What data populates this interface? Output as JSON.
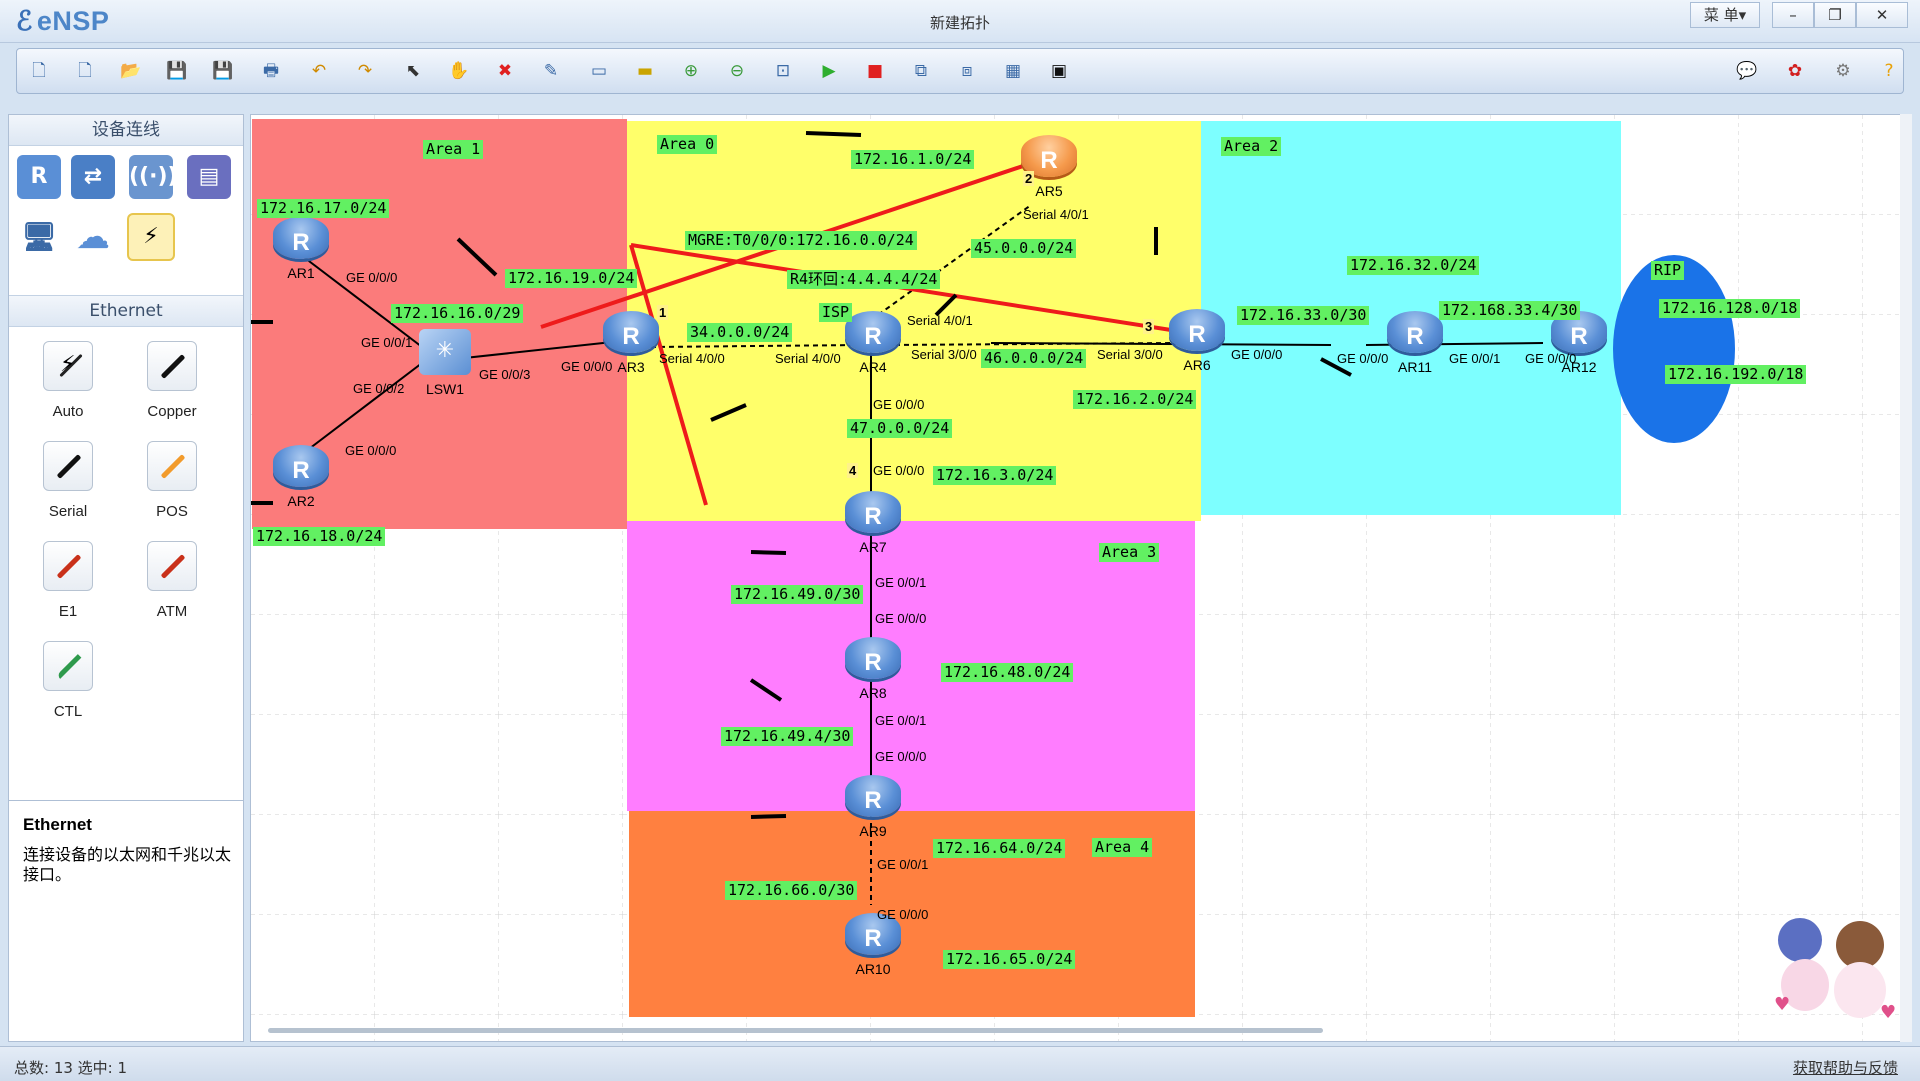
{
  "app": {
    "name": "eNSP",
    "window_title": "新建拓扑",
    "menu_label": "菜 单▾"
  },
  "toolbar": {
    "items": [
      "new-topology",
      "new-template",
      "open",
      "save",
      "save-as",
      "print",
      "undo",
      "redo",
      "select",
      "pan",
      "delete",
      "delete-links",
      "text",
      "rect",
      "zoom-in",
      "zoom-out",
      "fit",
      "start",
      "stop",
      "capture",
      "layout",
      "grid",
      "console"
    ]
  },
  "left_panel": {
    "devices_header": "设备连线",
    "ethernet_header": "Ethernet",
    "cables": [
      {
        "label": "Auto",
        "color": "#222"
      },
      {
        "label": "Copper",
        "color": "#111"
      },
      {
        "label": "Serial",
        "color": "#111"
      },
      {
        "label": "POS",
        "color": "#f29b2c"
      },
      {
        "label": "E1",
        "color": "#c9311a"
      },
      {
        "label": "ATM",
        "color": "#c9311a"
      },
      {
        "label": "CTL",
        "color": "#2e9a4c"
      }
    ],
    "desc_title": "Ethernet",
    "desc_text": "连接设备的以太网和千兆以太接口。"
  },
  "status": {
    "text": "总数: 13  选中: 1",
    "help": "获取帮助与反馈"
  },
  "areas": {
    "area1": "Area 1",
    "area0": "Area 0",
    "area2": "Area 2",
    "area3": "Area 3",
    "area4": "Area 4",
    "rip": "RIP"
  },
  "nodes": {
    "ar1": "AR1",
    "ar2": "AR2",
    "lsw1": "LSW1",
    "ar3": "AR3",
    "ar4": "AR4",
    "ar5": "AR5",
    "ar6": "AR6",
    "ar7": "AR7",
    "ar8": "AR8",
    "ar9": "AR9",
    "ar10": "AR10",
    "ar11": "AR11",
    "ar12": "AR12"
  },
  "nets": {
    "n1": "172.16.17.0/24",
    "n2": "172.16.16.0/29",
    "n3": "172.16.19.0/24",
    "n4": "172.16.18.0/24",
    "n5": "34.0.0.0/24",
    "n6": "172.16.1.0/24",
    "n7": "MGRE:T0/0/0:172.16.0.0/24",
    "n8": "45.0.0.0/24",
    "n9": "R4环回:4.4.4.4/24",
    "n10": "46.0.0.0/24",
    "n11": "47.0.0.0/24",
    "n12": "172.16.3.0/24",
    "n13": "172.16.2.0/24",
    "n14": "172.16.33.0/30",
    "n15": "172.16.32.0/24",
    "n16": "172.168.33.4/30",
    "n17": "172.16.128.0/18",
    "n18": "172.16.192.0/18",
    "n19": "172.16.49.0/30",
    "n20": "172.16.48.0/24",
    "n21": "172.16.49.4/30",
    "n22": "172.16.64.0/24",
    "n23": "172.16.66.0/30",
    "n24": "172.16.65.0/24",
    "isp": "ISP"
  },
  "ifaces": {
    "i1": "GE 0/0/0",
    "i2": "GE 0/0/1",
    "i3": "GE 0/0/2",
    "i4": "GE 0/0/3",
    "i5": "GE 0/0/0",
    "i6": "GE 0/0/0",
    "i7": "Serial 4/0/0",
    "i8": "Serial 4/0/0",
    "i9": "Serial 4/0/1",
    "i10": "Serial 3/0/0",
    "i11": "Serial 4/0/1",
    "i12": "Serial 3/0/0",
    "i13": "GE 0/0/0",
    "i14": "GE 0/0/0",
    "i15": "GE 0/0/1",
    "i16": "GE 0/0/0",
    "i17": "GE 0/0/0",
    "i18": "GE 0/0/0",
    "i19": "GE 0/0/1",
    "i20": "GE 0/0/0",
    "i21": "GE 0/0/1",
    "i22": "GE 0/0/0",
    "i23": "GE 0/0/1",
    "i24": "GE 0/0/0"
  },
  "marks": {
    "m1": "1",
    "m2": "2",
    "m3": "3",
    "m4": "4"
  },
  "colors": {
    "area1": "#fb7b7b",
    "area0": "#ffff6a",
    "area2": "#7dffff",
    "area3": "#ff7dff",
    "area4": "#ff8040",
    "rip": "#1a73e8",
    "tag": "#62f062",
    "mgre": "#ee1b1b"
  }
}
